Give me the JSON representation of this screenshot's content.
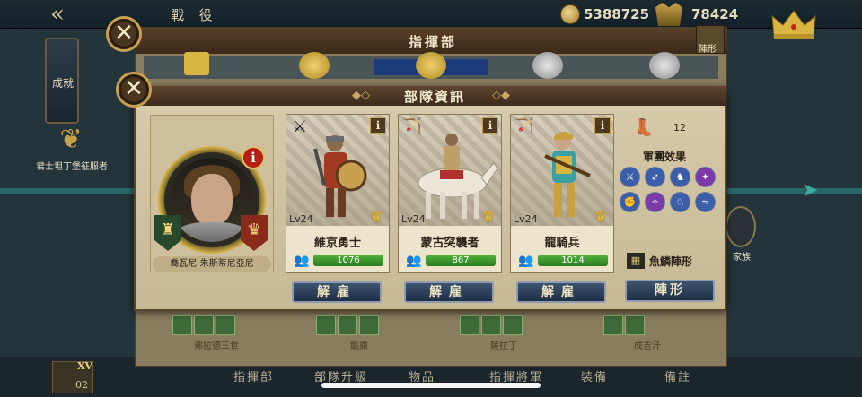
{
  "background": {
    "title": "戰 役",
    "gold": "5388725",
    "power": "78424",
    "achievement_label": "成就",
    "conqueror_label": "君士坦丁堡征服者",
    "right_label": "家族",
    "roman_a": "XV",
    "roman_b": "02",
    "bottom_tabs": [
      "指揮部",
      "部隊升級",
      "物品",
      "指揮將軍",
      "裝備",
      "備註"
    ],
    "bottom_squad_labels": [
      "弗拉德三世",
      "凱撒",
      "薩拉丁",
      "成吉汗"
    ]
  },
  "command_panel": {
    "title": "指揮部",
    "formation_label": "陣形"
  },
  "modal": {
    "title": "部隊資訊",
    "commander": {
      "name": "喬瓦尼·朱斯蒂尼亞尼",
      "info_badge": "i"
    },
    "units": [
      {
        "level": "Lv24",
        "name": "維京勇士",
        "troops": "1076",
        "fill": 1.0,
        "type_icon": "⚔",
        "info": "i"
      },
      {
        "level": "Lv24",
        "name": "蒙古突襲者",
        "troops": "867",
        "fill": 1.0,
        "type_icon": "🏹",
        "info": "i"
      },
      {
        "level": "Lv24",
        "name": "龍騎兵",
        "troops": "1014",
        "fill": 1.0,
        "type_icon": "🏹",
        "info": "i"
      }
    ],
    "dismiss_label": "解雇",
    "speed_value": "12",
    "effects_title": "軍團效果",
    "formation_name": "魚鱗陣形",
    "formation_button": "陣形"
  },
  "colors": {
    "accent_gold": "#c9a050",
    "button_blue": "#2b405a",
    "troop_green": "#3f9a2e"
  },
  "icons": [
    "close-icon",
    "info-icon",
    "crown-icon",
    "boot-icon",
    "troop-icon",
    "formation-icon"
  ]
}
